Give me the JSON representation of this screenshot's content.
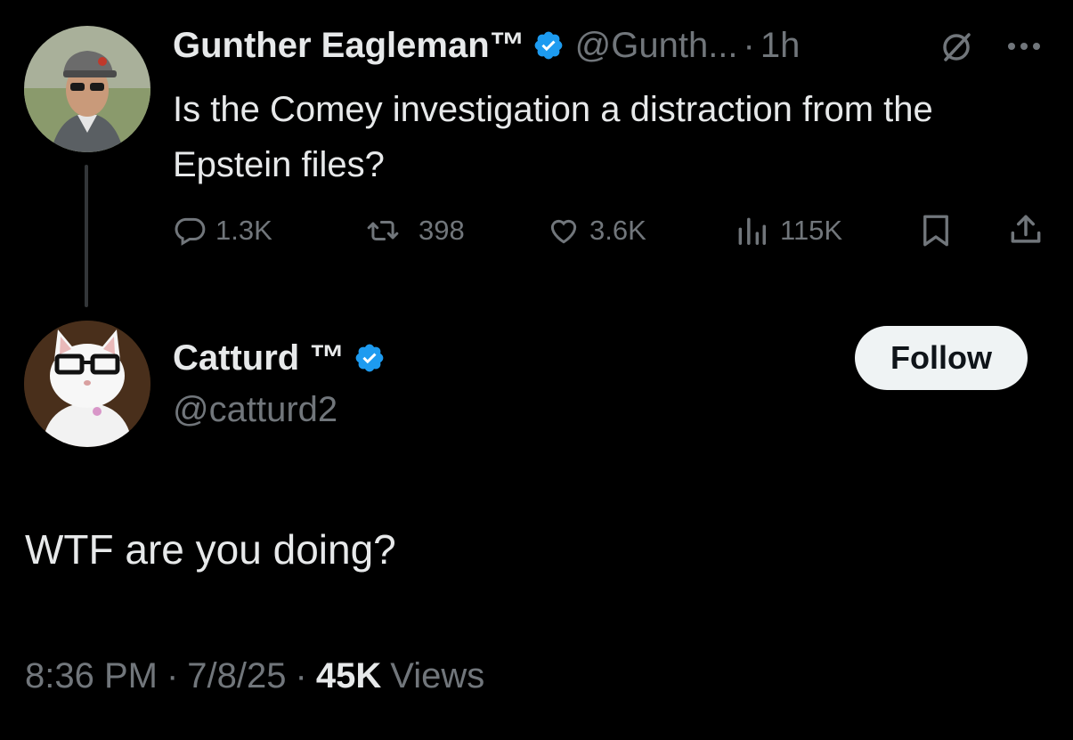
{
  "parent_tweet": {
    "author_name": "Gunther Eagleman™",
    "handle": "@Gunth...",
    "separator": "·",
    "time": "1h",
    "text": "Is the Comey investigation a distraction from the Epstein files?",
    "stats": {
      "replies": "1.3K",
      "retweets": "398",
      "likes": "3.6K",
      "views": "115K"
    }
  },
  "reply_tweet": {
    "author_name": "Catturd ™",
    "handle": "@catturd2",
    "follow_label": "Follow",
    "text": "WTF are you doing?",
    "time": "8:36 PM",
    "sep1": "·",
    "date": "7/8/25",
    "sep2": "·",
    "views_count": "45K",
    "views_label": "Views"
  },
  "colors": {
    "background": "#000000",
    "text": "#e7e9ea",
    "muted": "#71767b",
    "verified": "#1d9bf0",
    "follow_bg": "#eff3f4"
  },
  "icons": [
    "verified-badge-icon",
    "grok-slash-icon",
    "more-icon",
    "reply-icon",
    "retweet-icon",
    "like-icon",
    "views-icon",
    "bookmark-icon",
    "share-icon"
  ]
}
